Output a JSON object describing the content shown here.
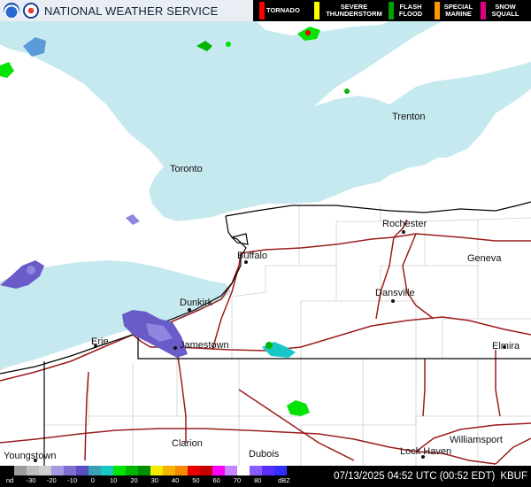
{
  "header": {
    "agency": "NATIONAL WEATHER SERVICE",
    "logos": [
      "noaa-logo",
      "nws-logo"
    ],
    "warnings": [
      {
        "id": "tornado",
        "label": "TORNADO",
        "color": "#ff0000"
      },
      {
        "id": "severe-thunderstorm",
        "label": "SEVERE THUNDERSTORM",
        "color": "#ffff00"
      },
      {
        "id": "flash-flood",
        "label": "FLASH FLOOD",
        "color": "#00a000"
      },
      {
        "id": "special-marine",
        "label": "SPECIAL MARINE",
        "color": "#ff9900"
      },
      {
        "id": "snow-squall",
        "label": "SNOW SQUALL",
        "color": "#e0007f"
      }
    ]
  },
  "map": {
    "colors": {
      "land": "#ffffff",
      "water": "#c6e9ef",
      "roads": "#9b1c1c",
      "borders": "#000000",
      "counties": "#cfcfcf"
    },
    "cities": [
      {
        "name": "Trenton"
      },
      {
        "name": "Toronto"
      },
      {
        "name": "Rochester"
      },
      {
        "name": "Buffalo"
      },
      {
        "name": "Geneva"
      },
      {
        "name": "Dansville"
      },
      {
        "name": "Dunkirk"
      },
      {
        "name": "Jamestown"
      },
      {
        "name": "Erie"
      },
      {
        "name": "Elmira"
      },
      {
        "name": "Williamsport"
      },
      {
        "name": "Clarion"
      },
      {
        "name": "Dubois"
      },
      {
        "name": "Lock Haven"
      },
      {
        "name": "Youngstown"
      }
    ]
  },
  "legend": {
    "nd_label": "nd",
    "ticks": [
      "-30",
      "-20",
      "-10",
      "0",
      "10",
      "20",
      "30",
      "40",
      "50",
      "60",
      "70",
      "80"
    ],
    "unit": "dBZ",
    "colors": [
      "#000000",
      "#9c9c9c",
      "#bdbdbd",
      "#cfcfcf",
      "#a59ae0",
      "#7d6ed0",
      "#5a4fc2",
      "#3aa0b4",
      "#19c6c6",
      "#04e404",
      "#01b501",
      "#008f00",
      "#f7e800",
      "#f6b300",
      "#f58a00",
      "#e80000",
      "#c40000",
      "#ff00ff",
      "#c486ff",
      "#ffffff",
      "#8a5bff",
      "#5a2eff",
      "#2f2fff"
    ],
    "timestamp": "07/13/2025 04:52 UTC (00:52 EDT)",
    "station": "KBUF"
  }
}
